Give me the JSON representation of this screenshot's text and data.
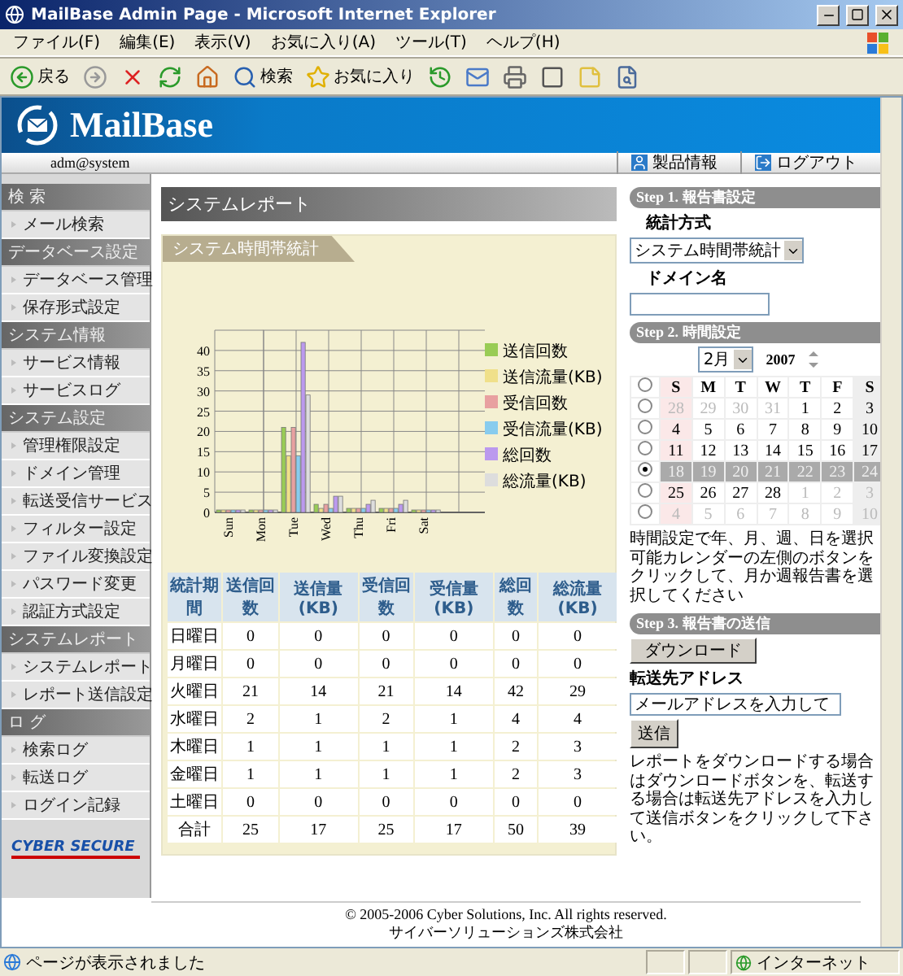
{
  "window": {
    "title": "MailBase Admin Page - Microsoft Internet Explorer"
  },
  "menu": [
    "ファイル(F)",
    "編集(E)",
    "表示(V)",
    "お気に入り(A)",
    "ツール(T)",
    "ヘルプ(H)"
  ],
  "toolbar": [
    {
      "kind": "back",
      "label": "戻る"
    },
    {
      "kind": "forward"
    },
    {
      "kind": "stop"
    },
    {
      "kind": "refresh"
    },
    {
      "kind": "home"
    },
    {
      "kind": "search",
      "label": "検索"
    },
    {
      "kind": "favorites",
      "label": "お気に入り"
    },
    {
      "kind": "history"
    },
    {
      "kind": "mail"
    },
    {
      "kind": "print"
    },
    {
      "kind": "edit"
    },
    {
      "kind": "note"
    },
    {
      "kind": "research"
    }
  ],
  "header": {
    "logo": "MailBase",
    "user": "adm@system",
    "links": [
      {
        "kind": "info",
        "label": "製品情報"
      },
      {
        "kind": "logout",
        "label": "ログアウト"
      }
    ]
  },
  "sidebar": {
    "sections": [
      {
        "title": "検 索",
        "items": [
          "メール検索"
        ]
      },
      {
        "title": "データベース設定",
        "items": [
          "データベース管理",
          "保存形式設定"
        ]
      },
      {
        "title": "システム情報",
        "items": [
          "サービス情報",
          "サービスログ"
        ]
      },
      {
        "title": "システム設定",
        "items": [
          "管理権限設定",
          "ドメイン管理",
          "転送受信サービス",
          "フィルター設定",
          "ファイル変換設定",
          "パスワード変更",
          "認証方式設定"
        ]
      },
      {
        "title": "システムレポート",
        "items": [
          "システムレポート",
          "レポート送信設定"
        ]
      },
      {
        "title": "ロ グ",
        "items": [
          "検索ログ",
          "転送ログ",
          "ログイン記録"
        ]
      }
    ],
    "logo": "CYBER SECURE"
  },
  "report": {
    "title": "システムレポート",
    "section": "システム時間帯統計",
    "chart_data": {
      "type": "bar",
      "grid": true,
      "legend": "right",
      "ylim": [
        0,
        45
      ],
      "categories": [
        "Sun",
        "Mon",
        "Tue",
        "Wed",
        "Thu",
        "Fri",
        "Sat"
      ],
      "yticks": [
        0,
        5,
        10,
        15,
        20,
        25,
        30,
        35,
        40
      ],
      "series": [
        {
          "name": "送信回数",
          "color": "#99cc55",
          "values": [
            0,
            0,
            21,
            2,
            1,
            1,
            0
          ]
        },
        {
          "name": "送信流量(KB)",
          "color": "#f0e08a",
          "values": [
            0,
            0,
            14,
            1,
            1,
            1,
            0
          ]
        },
        {
          "name": "受信回数",
          "color": "#e8a0a0",
          "values": [
            0,
            0,
            21,
            2,
            1,
            1,
            0
          ]
        },
        {
          "name": "受信流量(KB)",
          "color": "#88ccee",
          "values": [
            0,
            0,
            14,
            1,
            1,
            1,
            0
          ]
        },
        {
          "name": "総回数",
          "color": "#bb99ee",
          "values": [
            0,
            0,
            42,
            4,
            2,
            2,
            0
          ]
        },
        {
          "name": "総流量(KB)",
          "color": "#dddddd",
          "values": [
            0,
            0,
            29,
            4,
            3,
            3,
            0
          ]
        }
      ]
    },
    "table": {
      "columns": [
        "統計期間",
        "送信回数",
        "送信量(KB)",
        "受信回数",
        "受信量(KB)",
        "総回数",
        "総流量(KB)"
      ],
      "rows": [
        {
          "label": "日曜日",
          "values": [
            "0",
            "0",
            "0",
            "0",
            "0",
            "0"
          ]
        },
        {
          "label": "月曜日",
          "values": [
            "0",
            "0",
            "0",
            "0",
            "0",
            "0"
          ]
        },
        {
          "label": "火曜日",
          "values": [
            "21",
            "14",
            "21",
            "14",
            "42",
            "29"
          ]
        },
        {
          "label": "水曜日",
          "values": [
            "2",
            "1",
            "2",
            "1",
            "4",
            "4"
          ]
        },
        {
          "label": "木曜日",
          "values": [
            "1",
            "1",
            "1",
            "1",
            "2",
            "3"
          ]
        },
        {
          "label": "金曜日",
          "values": [
            "1",
            "1",
            "1",
            "1",
            "2",
            "3"
          ]
        },
        {
          "label": "土曜日",
          "values": [
            "0",
            "0",
            "0",
            "0",
            "0",
            "0"
          ]
        },
        {
          "label": "合計",
          "values": [
            "25",
            "17",
            "25",
            "17",
            "50",
            "39"
          ]
        }
      ]
    }
  },
  "step1": {
    "title": "Step 1. 報告書設定",
    "method_label": "統計方式",
    "method_value": "システム時間帯統計",
    "domain_label": "ドメイン名"
  },
  "step2": {
    "title": "Step 2. 時間設定",
    "month": "2月",
    "year": "2007",
    "weekday_row": {
      "selected": false,
      "labels": [
        "S",
        "M",
        "T",
        "W",
        "T",
        "F",
        "S"
      ]
    },
    "weeks": [
      {
        "selected": false,
        "days": [
          {
            "d": "28",
            "muted": true
          },
          {
            "d": "29",
            "muted": true
          },
          {
            "d": "30",
            "muted": true
          },
          {
            "d": "31",
            "muted": true
          },
          {
            "d": "1",
            "muted": false
          },
          {
            "d": "2",
            "muted": false
          },
          {
            "d": "3",
            "muted": false
          }
        ]
      },
      {
        "selected": false,
        "days": [
          {
            "d": "4",
            "muted": false
          },
          {
            "d": "5",
            "muted": false
          },
          {
            "d": "6",
            "muted": false
          },
          {
            "d": "7",
            "muted": false
          },
          {
            "d": "8",
            "muted": false
          },
          {
            "d": "9",
            "muted": false
          },
          {
            "d": "10",
            "muted": false
          }
        ]
      },
      {
        "selected": false,
        "days": [
          {
            "d": "11",
            "muted": false
          },
          {
            "d": "12",
            "muted": false
          },
          {
            "d": "13",
            "muted": false
          },
          {
            "d": "14",
            "muted": false
          },
          {
            "d": "15",
            "muted": false
          },
          {
            "d": "16",
            "muted": false
          },
          {
            "d": "17",
            "muted": false
          }
        ]
      },
      {
        "selected": true,
        "days": [
          {
            "d": "18",
            "muted": false
          },
          {
            "d": "19",
            "muted": false
          },
          {
            "d": "20",
            "muted": false
          },
          {
            "d": "21",
            "muted": false
          },
          {
            "d": "22",
            "muted": false
          },
          {
            "d": "23",
            "muted": false
          },
          {
            "d": "24",
            "muted": false
          }
        ]
      },
      {
        "selected": false,
        "days": [
          {
            "d": "25",
            "muted": false
          },
          {
            "d": "26",
            "muted": false
          },
          {
            "d": "27",
            "muted": false
          },
          {
            "d": "28",
            "muted": false
          },
          {
            "d": "1",
            "muted": true
          },
          {
            "d": "2",
            "muted": true
          },
          {
            "d": "3",
            "muted": true
          }
        ]
      },
      {
        "selected": false,
        "days": [
          {
            "d": "4",
            "muted": true
          },
          {
            "d": "5",
            "muted": true
          },
          {
            "d": "6",
            "muted": true
          },
          {
            "d": "7",
            "muted": true
          },
          {
            "d": "8",
            "muted": true
          },
          {
            "d": "9",
            "muted": true
          },
          {
            "d": "10",
            "muted": true
          }
        ]
      }
    ],
    "note": "時間設定で年、月、週、日を選択可能カレンダーの左側のボタンをクリックして、月か週報告書を選択してください"
  },
  "step3": {
    "title": "Step 3. 報告書の送信",
    "download": "ダウンロード",
    "address_label": "転送先アドレス",
    "address_value": "メールアドレスを入力して",
    "send": "送信",
    "note": "レポートをダウンロードする場合はダウンロードボタンを、転送する場合は転送先アドレスを入力して送信ボタンをクリックして下さい。"
  },
  "footer": {
    "copyright": "© 2005-2006 Cyber Solutions, Inc. All rights reserved.",
    "company": "サイバーソリューションズ株式会社"
  },
  "status_bar": {
    "text": "ページが表示されました",
    "zone": "インターネット"
  }
}
